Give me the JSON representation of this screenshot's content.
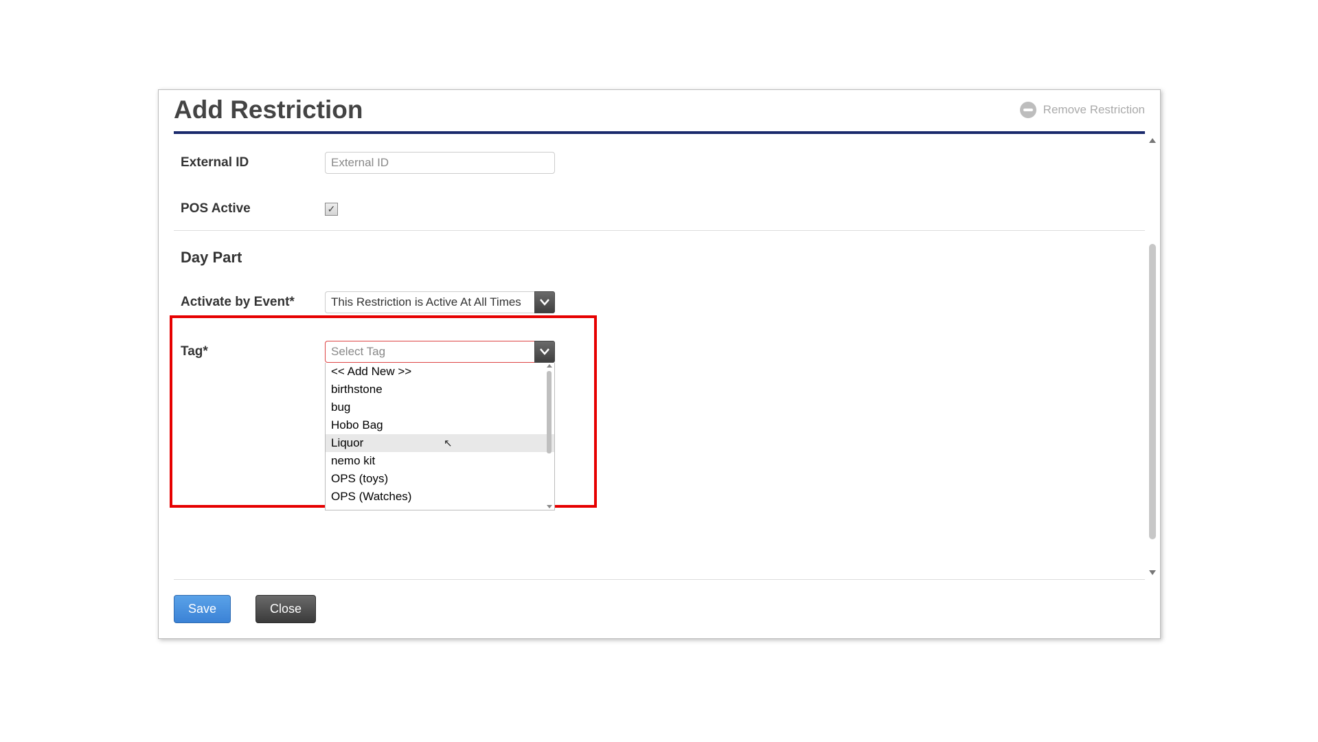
{
  "header": {
    "title": "Add Restriction",
    "remove_label": "Remove Restriction"
  },
  "fields": {
    "external_id": {
      "label": "External ID",
      "placeholder": "External ID",
      "value": ""
    },
    "pos_active": {
      "label": "POS Active",
      "checked": true
    },
    "day_part_section": "Day Part",
    "activate_by_event": {
      "label": "Activate by Event*",
      "value": "This Restriction is Active At All Times"
    },
    "tag": {
      "label": "Tag*",
      "placeholder": "Select Tag",
      "options": [
        "<< Add New >>",
        "birthstone",
        "bug",
        "Hobo Bag",
        "Liquor",
        "nemo kit",
        "OPS (toys)",
        "OPS (Watches)"
      ],
      "hovered_index": 4
    }
  },
  "footer": {
    "save": "Save",
    "close": "Close"
  }
}
